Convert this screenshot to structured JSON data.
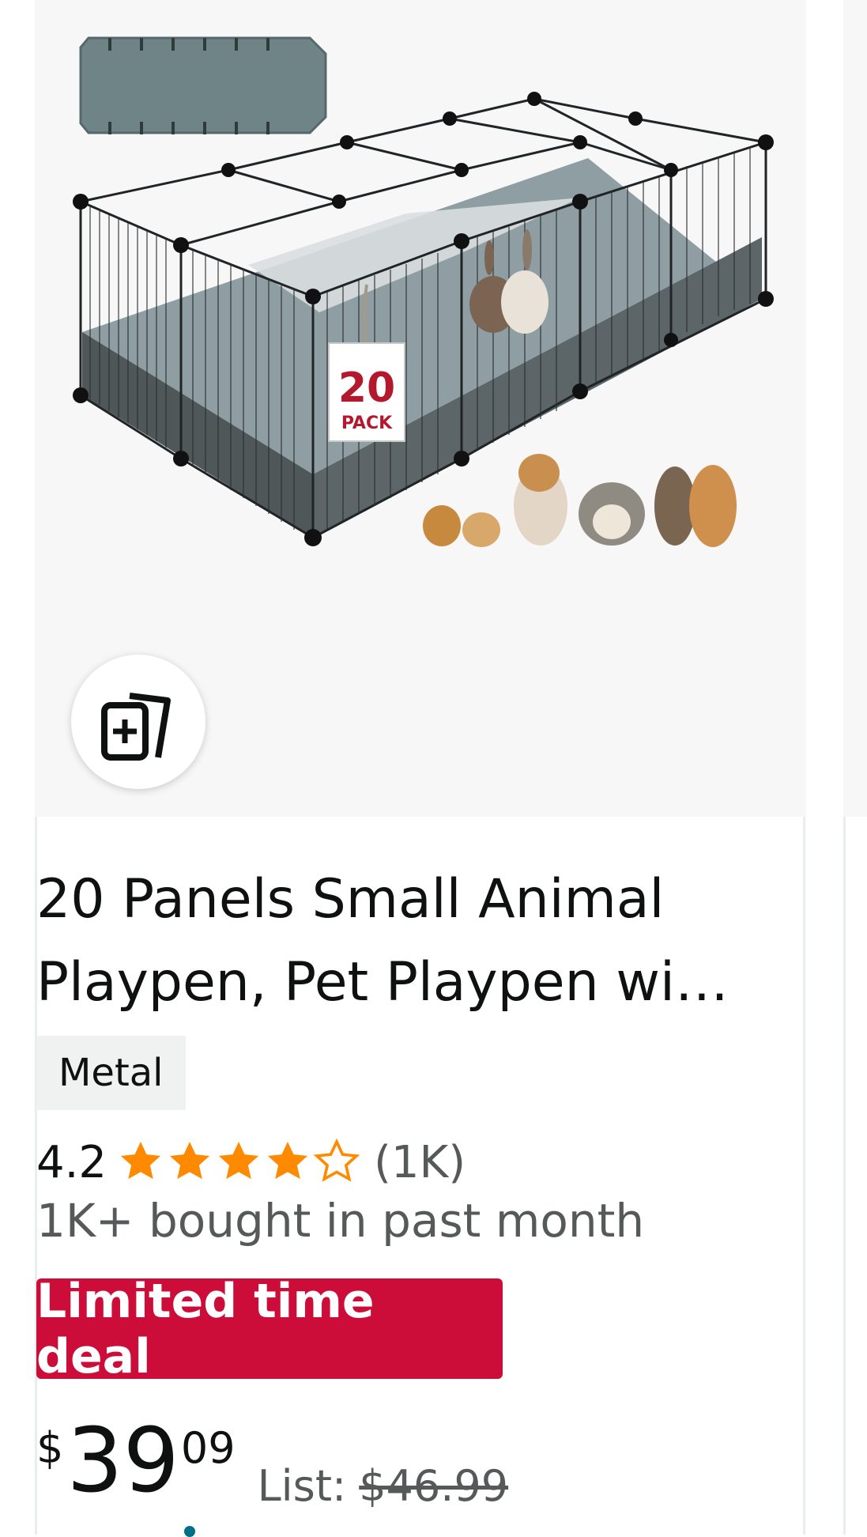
{
  "product": {
    "title_line1": "20 Panels Small Animal",
    "title_line2": "Playpen, Pet Playpen wi…",
    "material_badge": "Metal",
    "rating": "4.2",
    "rating_count": "(1K)",
    "stars_filled": 4.2,
    "stars_total": 5,
    "bought_text": "1K+ bought in past month",
    "deal_label": "Limited time deal",
    "price_symbol": "$",
    "price_whole": "39",
    "price_fraction": "09",
    "list_label": "List:",
    "list_price": "$46.99",
    "image_tag_number": "20",
    "image_tag_text": "PACK"
  },
  "colors": {
    "star": "#ff8a00",
    "deal": "#cc0c39",
    "image_bg": "#f7f7f7"
  },
  "icons": {
    "compare": "add-to-compare-icon"
  }
}
